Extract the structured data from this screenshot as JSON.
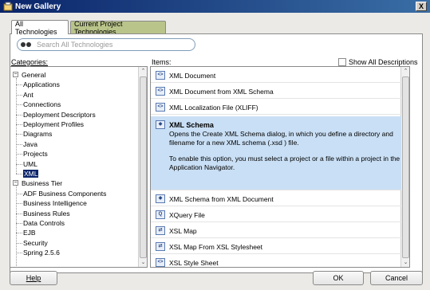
{
  "window": {
    "title": "New Gallery",
    "close_glyph": "X"
  },
  "tabs": [
    {
      "label": "All Technologies",
      "active": true
    },
    {
      "label": "Current Project Technologies",
      "active": false
    }
  ],
  "search": {
    "placeholder": "Search All Technologies"
  },
  "categories": {
    "label": "Categories:",
    "tree": [
      {
        "label": "General",
        "level": 0,
        "expanded": true
      },
      {
        "label": "Applications",
        "level": 1
      },
      {
        "label": "Ant",
        "level": 1
      },
      {
        "label": "Connections",
        "level": 1
      },
      {
        "label": "Deployment Descriptors",
        "level": 1
      },
      {
        "label": "Deployment Profiles",
        "level": 1
      },
      {
        "label": "Diagrams",
        "level": 1
      },
      {
        "label": "Java",
        "level": 1
      },
      {
        "label": "Projects",
        "level": 1
      },
      {
        "label": "UML",
        "level": 1
      },
      {
        "label": "XML",
        "level": 1,
        "selected": true
      },
      {
        "label": "Business Tier",
        "level": 0,
        "expanded": true
      },
      {
        "label": "ADF Business Components",
        "level": 1
      },
      {
        "label": "Business Intelligence",
        "level": 1
      },
      {
        "label": "Business Rules",
        "level": 1
      },
      {
        "label": "Data Controls",
        "level": 1
      },
      {
        "label": "EJB",
        "level": 1
      },
      {
        "label": "Security",
        "level": 1
      },
      {
        "label": "Spring 2.5.6",
        "level": 1
      }
    ]
  },
  "items": {
    "label": "Items:",
    "show_all_label": "Show All Descriptions",
    "list": [
      {
        "label": "XML Document",
        "icon": "xml-file-icon"
      },
      {
        "label": "XML Document from XML Schema",
        "icon": "xml-file-icon"
      },
      {
        "label": "XML Localization File (XLIFF)",
        "icon": "xml-file-icon"
      },
      {
        "label": "XML Schema",
        "icon": "xml-schema-icon",
        "selected": true,
        "desc1": "Opens the Create XML Schema dialog, in which you define a directory and filename for a new XML schema (.xsd ) file.",
        "desc2": "To enable this option, you must select a project or a file within a project in the Application Navigator."
      },
      {
        "label": "XML Schema from XML Document",
        "icon": "xml-schema-icon"
      },
      {
        "label": "XQuery File",
        "icon": "xquery-icon"
      },
      {
        "label": "XSL Map",
        "icon": "xsl-map-icon"
      },
      {
        "label": "XSL Map From XSL Stylesheet",
        "icon": "xsl-map-icon"
      },
      {
        "label": "XSL Style Sheet",
        "icon": "xml-file-icon"
      }
    ]
  },
  "buttons": {
    "help": "Help",
    "ok": "OK",
    "cancel": "Cancel"
  }
}
